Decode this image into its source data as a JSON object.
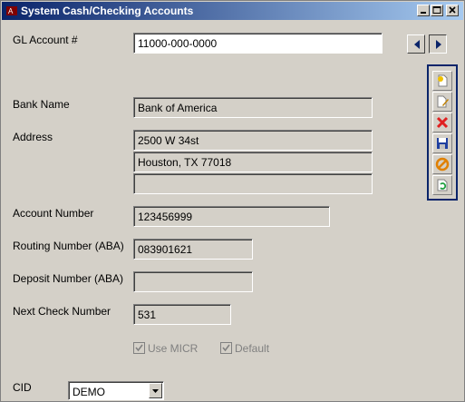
{
  "window": {
    "title": "System Cash/Checking Accounts"
  },
  "form": {
    "gl_account_label": "GL Account #",
    "gl_account_value": "11000-000-0000",
    "bank_name_label": "Bank Name",
    "bank_name_value": "Bank of America",
    "address_label": "Address",
    "address_line1": "2500 W 34st",
    "address_line2": "Houston, TX 77018",
    "address_line3": "",
    "account_number_label": "Account Number",
    "account_number_value": "123456999",
    "routing_label": "Routing Number (ABA)",
    "routing_value": "083901621",
    "deposit_label": "Deposit Number (ABA)",
    "deposit_value": "",
    "next_check_label": "Next Check Number",
    "next_check_value": "531",
    "use_micr_label": "Use MICR",
    "use_micr_checked": true,
    "default_label": "Default",
    "default_checked": true,
    "cid_label": "CID",
    "cid_value": "DEMO"
  },
  "icons": [
    "app-icon",
    "minimize-icon",
    "maximize-icon",
    "close-icon",
    "prev-arrow-icon",
    "next-arrow-icon",
    "new-record-icon",
    "edit-icon",
    "delete-icon",
    "save-icon",
    "cancel-icon",
    "refresh-icon",
    "dropdown-arrow-icon"
  ]
}
